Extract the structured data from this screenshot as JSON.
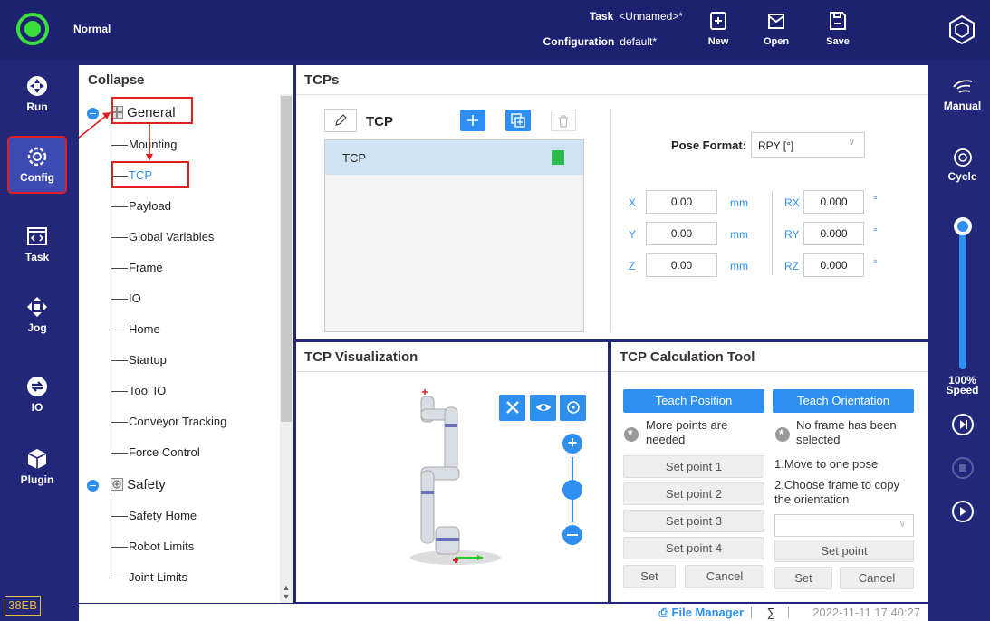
{
  "topbar": {
    "mode": "Normal",
    "task_label": "Task",
    "task_value": "<Unnamed>*",
    "config_label": "Configuration",
    "config_value": "default*",
    "buttons": [
      {
        "label": "New",
        "icon": "new-file-icon"
      },
      {
        "label": "Open",
        "icon": "open-folder-icon"
      },
      {
        "label": "Save",
        "icon": "save-icon"
      }
    ],
    "status_color": "#3ddc3d"
  },
  "leftnav": {
    "items": [
      {
        "label": "Run",
        "icon": "run-icon"
      },
      {
        "label": "Config",
        "icon": "gear-icon",
        "active": true
      },
      {
        "label": "Task",
        "icon": "code-icon"
      },
      {
        "label": "Jog",
        "icon": "move-arrows-icon"
      },
      {
        "label": "IO",
        "icon": "io-icon"
      },
      {
        "label": "Plugin",
        "icon": "plugin-cube-icon"
      }
    ],
    "badge": "38EB"
  },
  "rightbar": {
    "manual": "Manual",
    "cycle": "Cycle",
    "speed_value": "100%",
    "speed_label": "Speed",
    "speed_fraction": 1.0
  },
  "tree": {
    "title": "Collapse",
    "general": {
      "label": "General",
      "items": [
        "Mounting",
        "TCP",
        "Payload",
        "Global Variables",
        "Frame",
        "IO",
        "Home",
        "Startup",
        "Tool IO",
        "Conveyor Tracking",
        "Force Control"
      ]
    },
    "safety": {
      "label": "Safety",
      "items": [
        "Safety Home",
        "Robot Limits",
        "Joint Limits"
      ]
    }
  },
  "tcps": {
    "title": "TCPs",
    "header": "TCP",
    "list": [
      "TCP"
    ],
    "pose_format_label": "Pose Format:",
    "pose_format_value": "RPY [°]",
    "coords": [
      {
        "axis": "X",
        "value": "0.00",
        "unit": "mm"
      },
      {
        "axis": "Y",
        "value": "0.00",
        "unit": "mm"
      },
      {
        "axis": "Z",
        "value": "0.00",
        "unit": "mm"
      }
    ],
    "rotations": [
      {
        "axis": "RX",
        "value": "0.000",
        "unit": "°"
      },
      {
        "axis": "RY",
        "value": "0.000",
        "unit": "°"
      },
      {
        "axis": "RZ",
        "value": "0.000",
        "unit": "°"
      }
    ]
  },
  "viz": {
    "title": "TCP Visualization"
  },
  "calc": {
    "title": "TCP Calculation Tool",
    "teach_position": "Teach Position",
    "teach_orientation": "Teach Orientation",
    "pos_info_line1": "More points are",
    "pos_info_line2": "needed",
    "ori_info_line1": "No frame has been",
    "ori_info_line2": "selected",
    "set_points": [
      "Set point 1",
      "Set point 2",
      "Set point 3",
      "Set point 4"
    ],
    "set": "Set",
    "cancel": "Cancel",
    "step1": "1.Move to one pose",
    "step2_line1": "2.Choose frame to copy",
    "step2_line2": "the orientation",
    "set_point": "Set point"
  },
  "statusbar": {
    "file_manager": "File Manager",
    "timestamp": "2022-11-11 17:40:27"
  },
  "colors": {
    "accent": "#2f8ff0",
    "nav_bg": "#22277a",
    "highlight": "#e02020"
  }
}
